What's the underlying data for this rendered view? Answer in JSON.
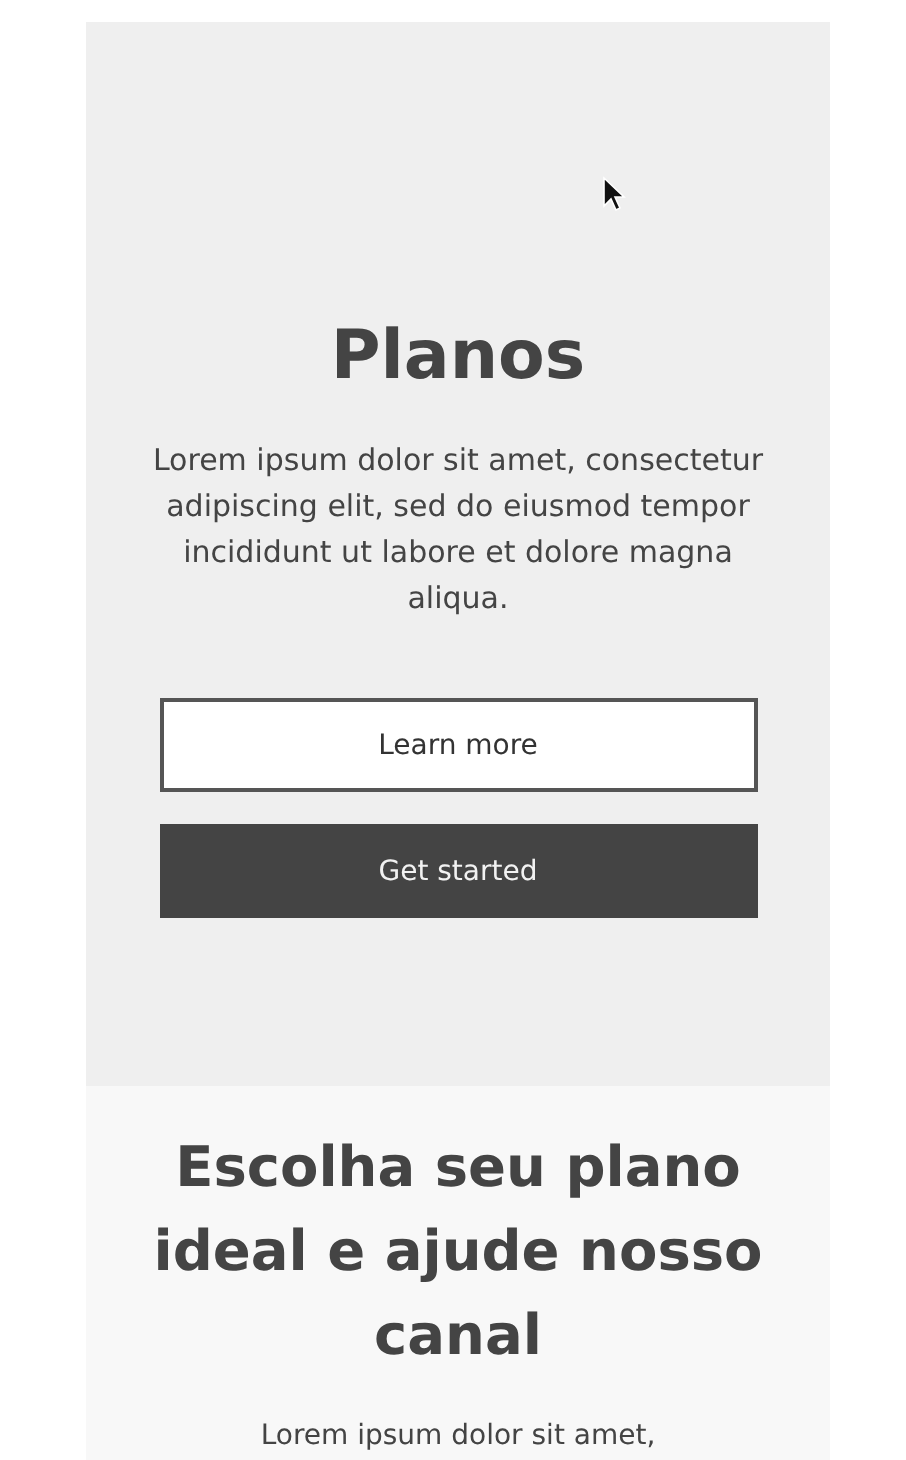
{
  "hero": {
    "title": "Planos",
    "text": "Lorem ipsum dolor sit amet, consectetur adipiscing elit, sed do eiusmod tempor incididunt ut labore et dolore magna aliqua.",
    "buttons": [
      {
        "label": "Learn more",
        "kind": "outline"
      },
      {
        "label": "Get started",
        "kind": "filled"
      }
    ]
  },
  "plans": {
    "title": "Escolha seu plano ideal e ajude nosso canal",
    "text": "Lorem ipsum dolor sit amet,"
  }
}
